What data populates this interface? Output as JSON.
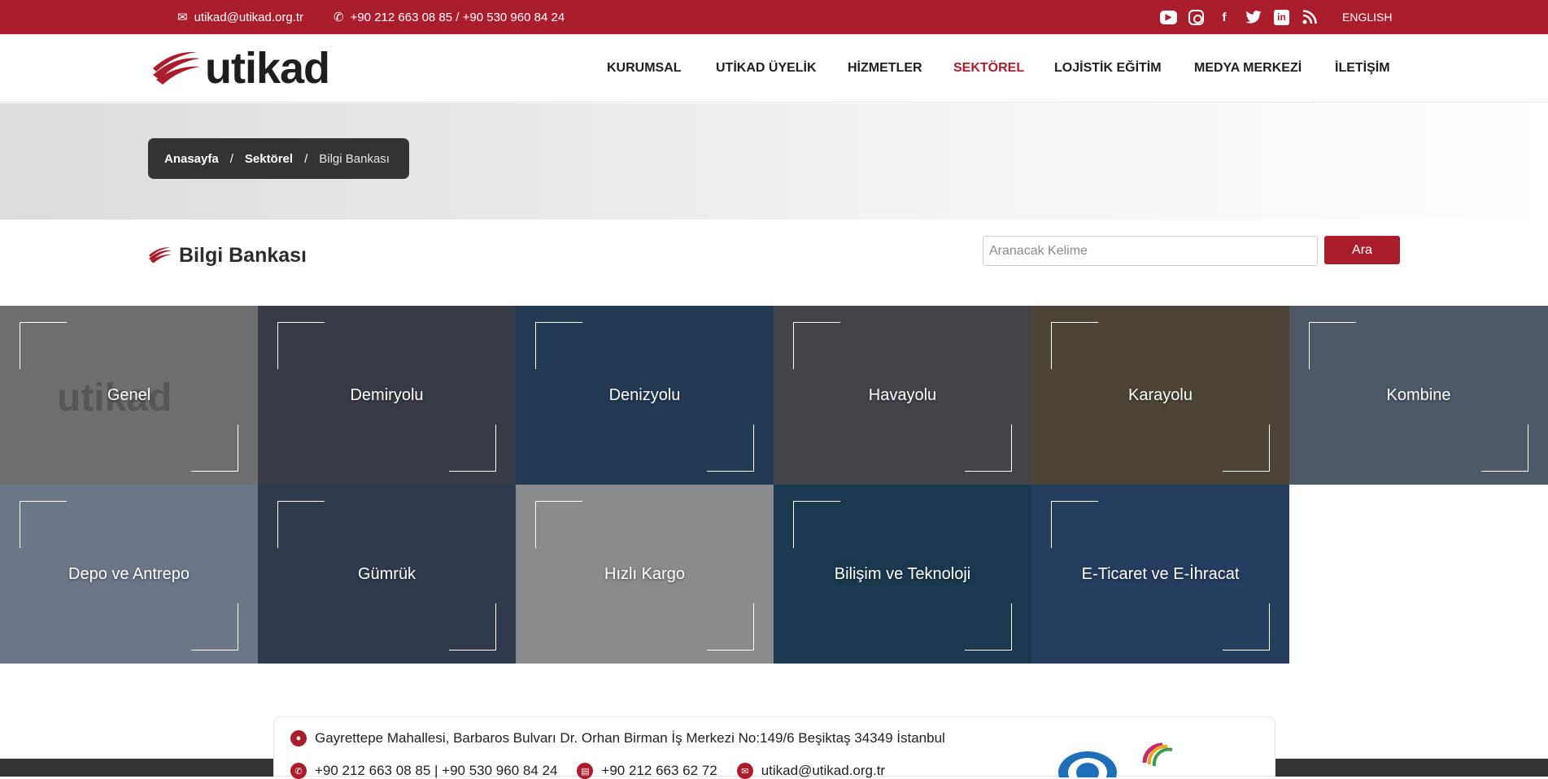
{
  "topbar": {
    "email": "utikad@utikad.org.tr",
    "phone": "+90 212 663 08 85 / +90 530 960 84 24",
    "social": [
      "youtube-icon",
      "instagram-icon",
      "facebook-icon",
      "twitter-icon",
      "linkedin-icon",
      "rss-icon"
    ],
    "language": "ENGLISH"
  },
  "header": {
    "logo": "utikad",
    "nav": [
      "KURUMSAL",
      "UTİKAD ÜYELİK",
      "HİZMETLER",
      "SEKTÖREL",
      "LOJİSTİK EĞİTİM",
      "MEDYA MERKEZİ",
      "İLETİŞİM"
    ],
    "active_nav": "SEKTÖREL"
  },
  "breadcrumb": {
    "home": "Anasayfa",
    "section": "Sektörel",
    "current": "Bilgi Bankası",
    "separator": "/"
  },
  "main": {
    "title": "Bilgi Bankası",
    "search_placeholder": "Aranacak Kelime",
    "search_button": "Ara"
  },
  "tiles": [
    {
      "label": "Genel",
      "color": "#6f6f6f"
    },
    {
      "label": "Demiryolu",
      "color": "#4a4c52"
    },
    {
      "label": "Denizyolu",
      "color": "#2c4a6a"
    },
    {
      "label": "Havayolu",
      "color": "#5b5a58"
    },
    {
      "label": "Karayolu",
      "color": "#6a5a3c"
    },
    {
      "label": "Kombine",
      "color": "#6e7a88"
    },
    {
      "label": "Depo ve Antrepo",
      "color": "#9aa6b8"
    },
    {
      "label": "Gümrük",
      "color": "#3e4c5e"
    },
    {
      "label": "Hızlı Kargo",
      "color": "#c9c6c1"
    },
    {
      "label": "Bilişim ve Teknoloji",
      "color": "#1f4960"
    },
    {
      "label": "E-Ticaret ve E-İhracat",
      "color": "#2f4f7a"
    }
  ],
  "footer": {
    "address": "Gayrettepe Mahallesi, Barbaros Bulvarı Dr. Orhan Birman İş Merkezi No:149/6 Beşiktaş 34349 İstanbul",
    "phone": "+90 212 663 08 85 | +90 530 960 84 24",
    "fax": "+90 212 663 62 72",
    "email": "utikad@utikad.org.tr",
    "partners": [
      "FIATA",
      "CLECAT"
    ]
  },
  "colors": {
    "brand": "#a91d2c",
    "dark": "#333333"
  }
}
